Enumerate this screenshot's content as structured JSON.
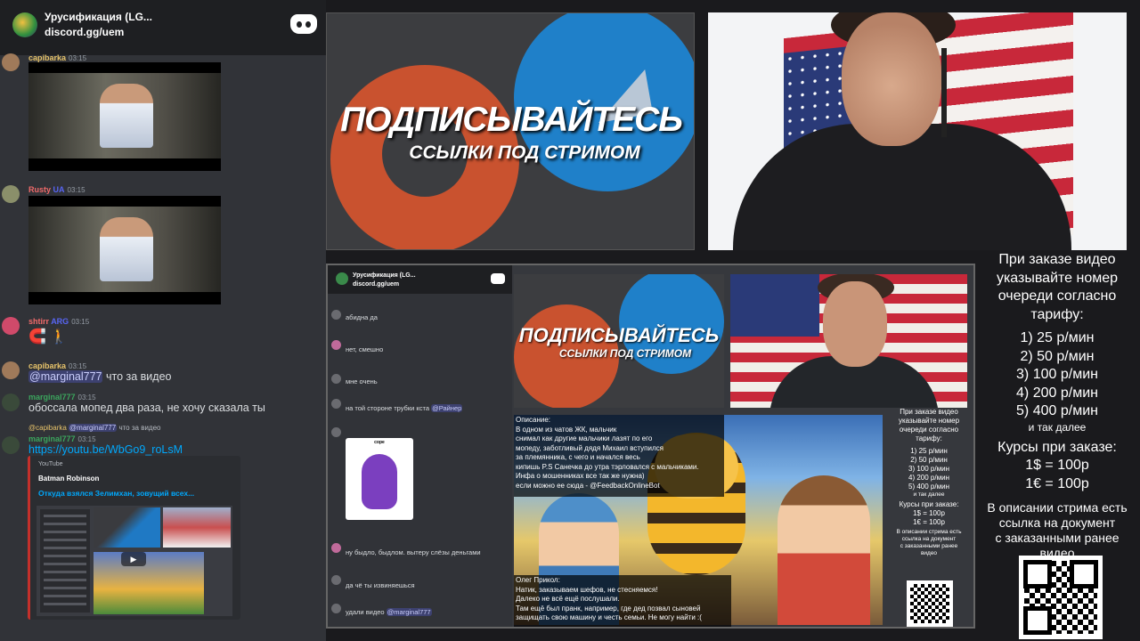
{
  "chat": {
    "server_name": "Урусификация (LG...",
    "server_link": "discord.gg/uem",
    "messages": [
      {
        "user": "capibarka",
        "time": "03:15"
      },
      {
        "user": "Rusty",
        "badge": "UA",
        "time": "03:15"
      },
      {
        "user": "shtirr",
        "badge": "ARG",
        "time": "03:15"
      },
      {
        "user": "capibarka",
        "time": "03:15",
        "mention": "@marginal777",
        "text": "что за видео"
      },
      {
        "user": "marginal777",
        "time": "03:15",
        "text": "обоссала мопед два раза, не хочу сказала ты"
      },
      {
        "reply_user": "@capibarka",
        "reply_mention": "@marginal777",
        "reply_text": "что за видео",
        "user": "marginal777",
        "time": "03:15",
        "link": "https://youtu.be/WbGo9_roLsM"
      }
    ],
    "embed": {
      "provider": "YouTube",
      "author": "Batman Robinson",
      "title": "Откуда взялся Зелимхан, зовущий всех..."
    }
  },
  "banner": {
    "title": "ПОДПИСЫВАЙТЕСЬ",
    "subtitle": "ССЫЛКИ ПОД СТРИМОМ"
  },
  "nested": {
    "server_name": "Урусификация (LG...",
    "server_link": "discord.gg/uem",
    "lines": [
      "абидна да",
      "нет, смешно",
      "мне очень",
      "на той стороне трубки кста",
      "ну быдло, быдлом. вытеру слёзы деньгами",
      "да чё ты извиняешься",
      "удали видео"
    ],
    "mention_1": "@Райнер",
    "mention_2": "@marginal777",
    "sticker_caption": "cope",
    "banner_title": "ПОДПИСЫВАЙТЕСЬ",
    "banner_subtitle": "ССЫЛКИ ПОД СТРИМОМ",
    "description": [
      "Описание:",
      "В одном из чатов ЖК, мальчик",
      "снимал как другие мальчики лазят по его",
      "мопеду, заботливый дядя Михаил вступился",
      "за племянника, с чего и начался весь",
      "кипишь P.S Санечка до утра тэрловался с мальчиками.",
      "Инфа о мошенниках все так же нужна)",
      "если можно ее сюда - @FeedbackOnlineBot"
    ],
    "joke": [
      "Олег Прикол:",
      "Натик, заказываем шефов, не стесняемся!",
      "Далеко не всё ещё послушали.",
      "Там ещё был пранк, например, где дед позвал сыновей",
      "защищать свою машину и честь семьи. Не могу найти :("
    ],
    "pricing": {
      "intro": [
        "При заказе видео",
        "указывайте номер",
        "очереди согласно",
        "тарифу:"
      ],
      "tiers": [
        "1) 25 р/мин",
        "2) 50 р/мин",
        "3) 100 р/мин",
        "4) 200 р/мин",
        "5) 400 р/мин"
      ],
      "etc": "и так далее",
      "rates_title": "Курсы при заказе:",
      "rates": [
        "1$ = 100р",
        "1€ = 100р"
      ],
      "doc_note": [
        "В описании стрима есть",
        "ссылка на документ",
        "с заказанными ранее",
        "видео"
      ]
    }
  },
  "pricing": {
    "intro": [
      "При заказе видео",
      "указывайте номер",
      "очереди согласно",
      "тарифу:"
    ],
    "tiers": [
      "1) 25 р/мин",
      "2) 50 р/мин",
      "3) 100 р/мин",
      "4) 200 р/мин",
      "5) 400 р/мин"
    ],
    "etc": "и так далее",
    "rates_title": "Курсы при заказе:",
    "rates": [
      "1$ = 100р",
      "1€ = 100р"
    ],
    "doc_note": [
      "В описании стрима есть",
      "ссылка на документ",
      "с заказанными ранее",
      "видео"
    ]
  },
  "colors": {
    "discord_bg": "#313338",
    "header_bg": "#1e1f22",
    "link": "#00a8fc",
    "mention_bg": "#5865f2",
    "brand_orange": "#c9522f",
    "telegram_blue": "#1f80c9"
  }
}
